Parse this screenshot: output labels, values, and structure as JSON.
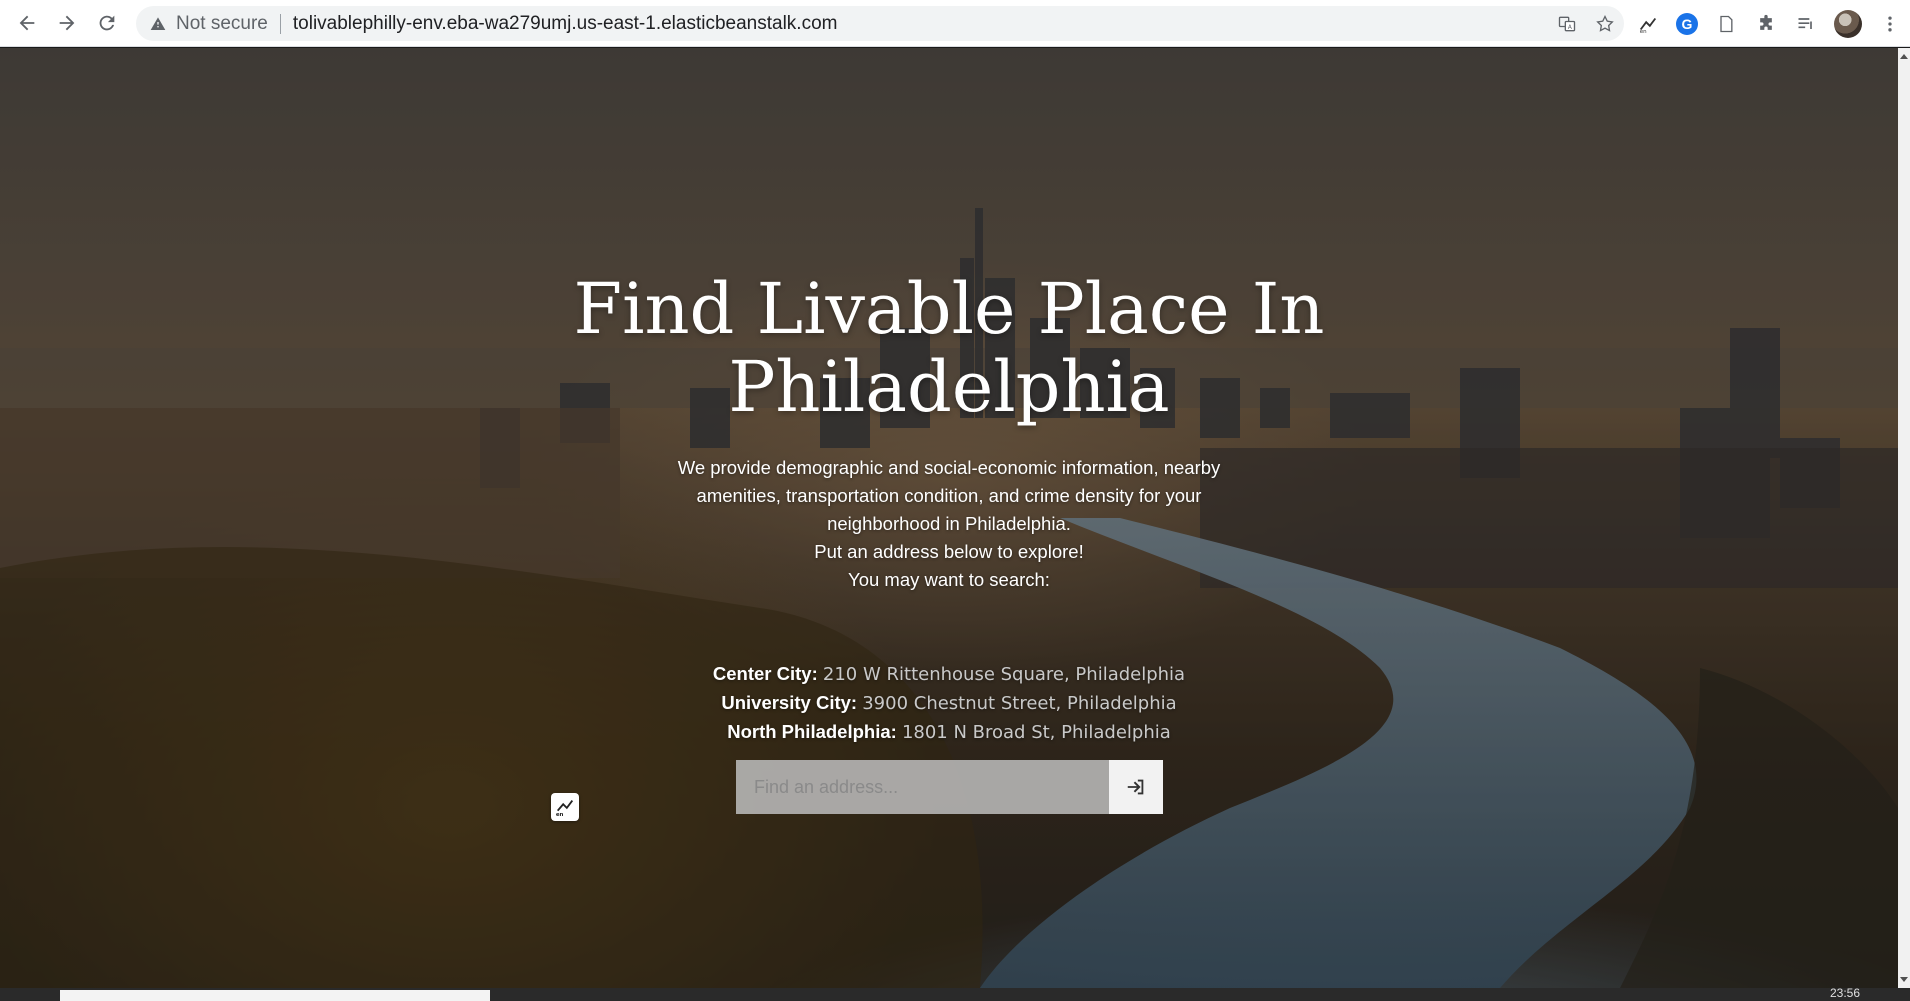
{
  "browser": {
    "security_label": "Not secure",
    "url": "tolivablephilly-env.eba-wa279umj.us-east-1.elasticbeanstalk.com",
    "icons": [
      "back-arrow-icon",
      "forward-arrow-icon",
      "reload-icon",
      "warning-icon",
      "translate-icon",
      "star-icon",
      "grammarly-icon",
      "extensions-icon",
      "reading-list-icon",
      "profile-avatar",
      "more-menu-icon"
    ]
  },
  "hero": {
    "title": "Find Livable Place In Philadelphia",
    "description_lines": [
      "We provide demographic and social-economic information, nearby",
      "amenities, transportation condition, and crime density for your",
      "neighborhood in Philadelphia.",
      "Put an address below to explore!",
      "You may want to search:"
    ]
  },
  "examples": [
    {
      "label": "Center City:",
      "address": "210 W Rittenhouse Square, Philadelphia"
    },
    {
      "label": "University City:",
      "address": "3900 Chestnut Street, Philadelphia"
    },
    {
      "label": "North Philadelphia:",
      "address": "1801 N Broad St, Philadelphia"
    }
  ],
  "search": {
    "placeholder": "Find an address...",
    "value": ""
  },
  "taskbar": {
    "clock": "23:56"
  }
}
